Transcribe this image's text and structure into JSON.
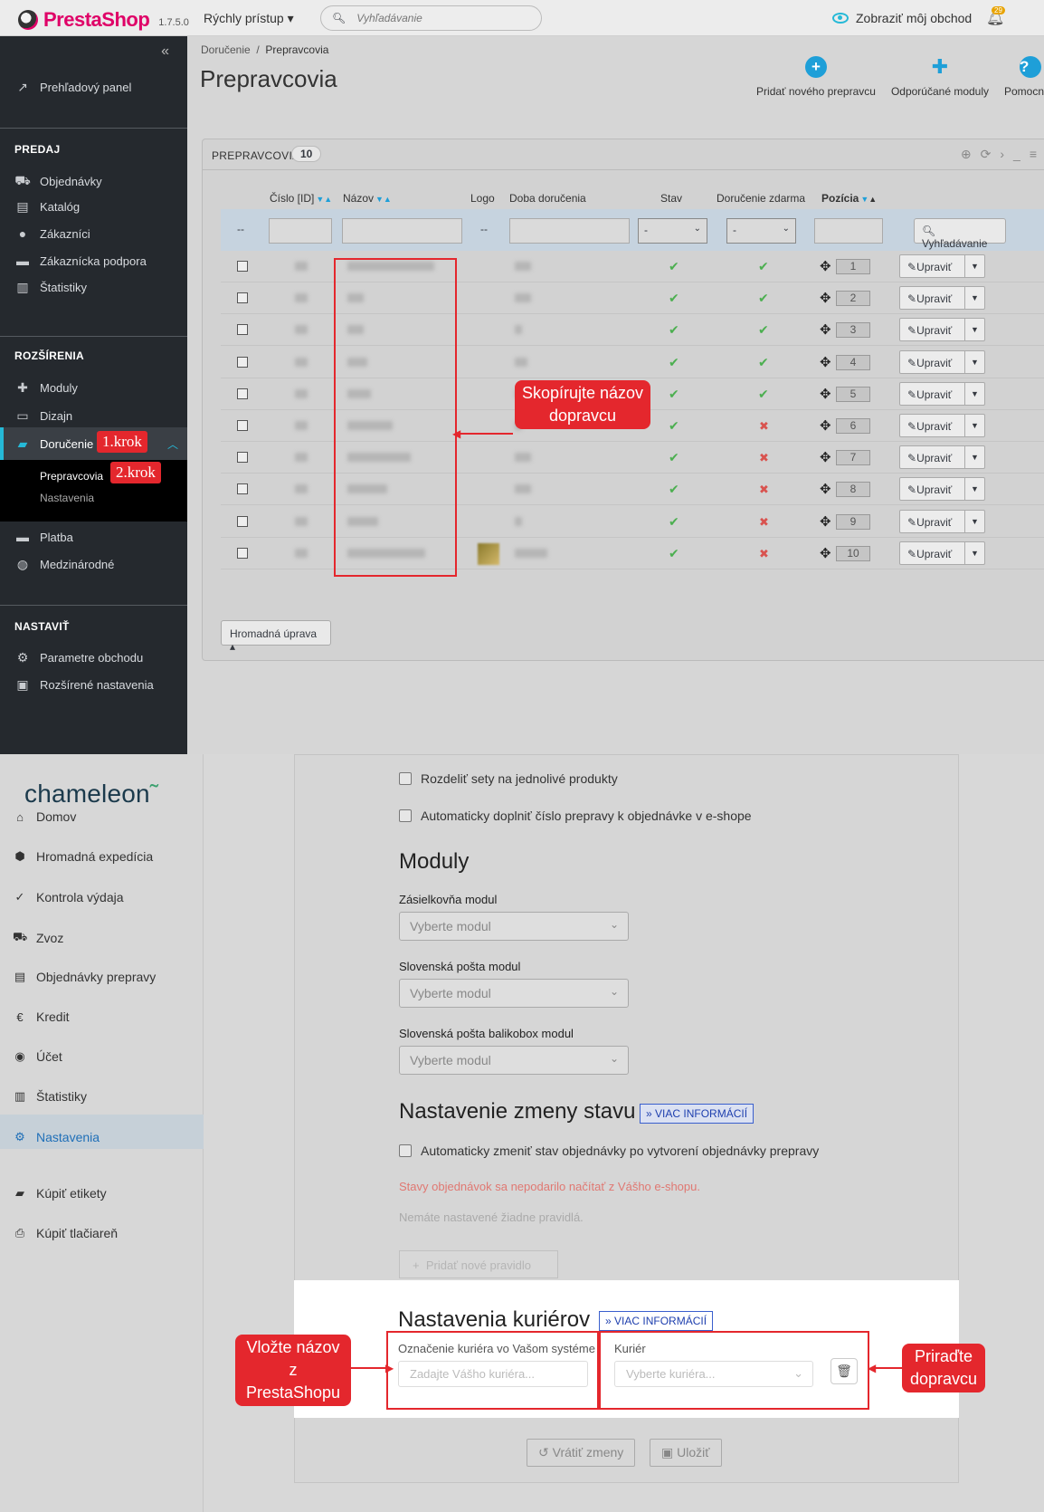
{
  "prestashop": {
    "brand": "PrestaShop",
    "version": "1.7.5.0",
    "quick_access": "Rýchly prístup",
    "search_placeholder": "Vyhľadávanie",
    "view_shop": "Zobraziť môj obchod",
    "notifications_count": "29",
    "sidebar": {
      "dashboard": "Prehľadový panel",
      "sections": [
        {
          "title": "PREDAJ",
          "items": [
            "Objednávky",
            "Katalóg",
            "Zákazníci",
            "Zákaznícka podpora",
            "Štatistiky"
          ]
        },
        {
          "title": "ROZŠÍRENIA",
          "items": [
            "Moduly",
            "Dizajn",
            "Doručenie"
          ]
        },
        {
          "title": "NASTAVIŤ",
          "items": [
            "Parametre obchodu",
            "Rozšírené nastavenia"
          ]
        }
      ],
      "delivery_sub": [
        "Prepravcovia",
        "Nastavenia"
      ],
      "after_delivery": [
        "Platba",
        "Medzinárodné"
      ]
    },
    "breadcrumb": [
      "Doručenie",
      "Prepravcovia"
    ],
    "page_title": "Prepravcovia",
    "toolbar": [
      "Pridať nového prepravcu",
      "Odporúčané moduly",
      "Pomocník"
    ],
    "panel_title": "PREPRAVCOVIA",
    "panel_count": "10",
    "columns": [
      "Číslo [ID]",
      "Názov",
      "Logo",
      "Doba doručenia",
      "Stav",
      "Doručenie zdarma",
      "Pozícia"
    ],
    "filter_placeholder_dash": "--",
    "filter_select_value": "-",
    "search_button": "Vyhľadávanie",
    "edit_label": "Upraviť",
    "bulk_label": "Hromadná úprava",
    "rows": [
      {
        "pos": "1",
        "status": true,
        "free": true
      },
      {
        "pos": "2",
        "status": true,
        "free": true
      },
      {
        "pos": "3",
        "status": true,
        "free": true
      },
      {
        "pos": "4",
        "status": true,
        "free": true
      },
      {
        "pos": "5",
        "status": true,
        "free": true
      },
      {
        "pos": "6",
        "status": true,
        "free": false
      },
      {
        "pos": "7",
        "status": true,
        "free": false
      },
      {
        "pos": "8",
        "status": true,
        "free": false
      },
      {
        "pos": "9",
        "status": true,
        "free": false
      },
      {
        "pos": "10",
        "status": true,
        "free": false
      }
    ],
    "annotations": {
      "step1": "1.krok",
      "step2": "2.krok",
      "copy_name": "Skopírujte názov dopravcu"
    }
  },
  "chameleon": {
    "brand": "chameleon",
    "sidebar": [
      "Domov",
      "Hromadná expedícia",
      "Kontrola výdaja",
      "Zvoz",
      "Objednávky prepravy",
      "Kredit",
      "Účet",
      "Štatistiky",
      "Nastavenia",
      "Kúpiť etikety",
      "Kúpiť tlačiareň"
    ],
    "checks": [
      "Rozdeliť sety na jednolivé produkty",
      "Automaticky doplniť číslo prepravy k objednávke v e-shope"
    ],
    "modules_title": "Moduly",
    "modules": [
      {
        "label": "Zásielkovňa modul",
        "placeholder": "Vyberte modul"
      },
      {
        "label": "Slovenská pošta modul",
        "placeholder": "Vyberte modul"
      },
      {
        "label": "Slovenská pošta balikobox modul",
        "placeholder": "Vyberte modul"
      }
    ],
    "status_title": "Nastavenie zmeny stavu",
    "more_info": "VIAC INFORMÁCIÍ",
    "status_check": "Automaticky zmeniť stav objednávky po vytvorení objednávky prepravy",
    "status_error": "Stavy objednávok sa nepodarilo načítať z Vášho e-shopu.",
    "no_rules": "Nemáte nastavené žiadne pravidlá.",
    "add_rule": "Pridať nové pravidlo",
    "couriers_title": "Nastavenia kuriérov",
    "courier_field_label": "Označenie kuriéra vo Vašom systéme",
    "courier_field_placeholder": "Zadajte Vášho kuriéra...",
    "courier_select_label": "Kuriér",
    "courier_select_placeholder": "Vyberte kuriéra...",
    "revert": "Vrátiť zmeny",
    "save": "Uložiť",
    "annotations": {
      "paste": "Vložte názov z PrestaShopu",
      "assign": "Priraďte dopravcu"
    }
  }
}
